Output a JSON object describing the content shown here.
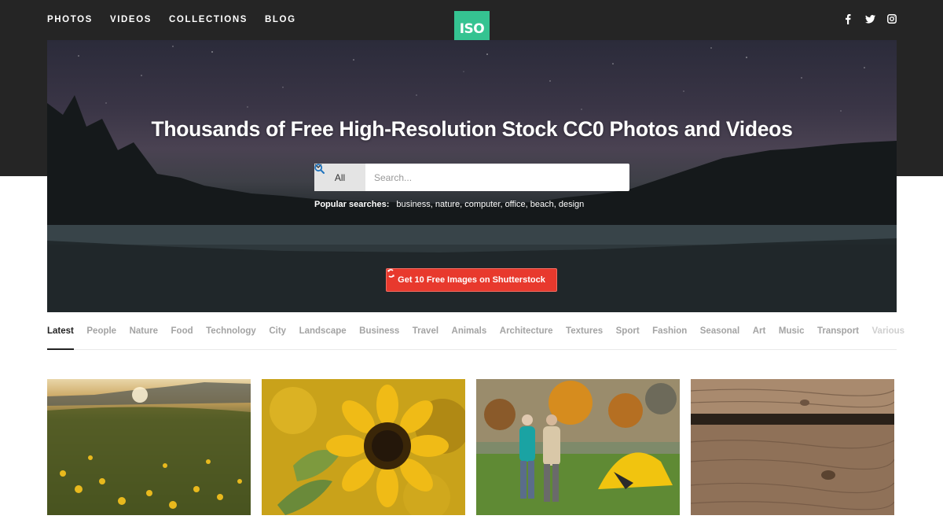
{
  "nav": {
    "items": [
      {
        "label": "PHOTOS"
      },
      {
        "label": "VIDEOS"
      },
      {
        "label": "COLLECTIONS"
      },
      {
        "label": "BLOG"
      }
    ]
  },
  "logo": {
    "text": "ISO",
    "color": "#35c391"
  },
  "social": [
    "facebook-icon",
    "twitter-icon",
    "instagram-icon"
  ],
  "hero": {
    "title": "Thousands of Free High-Resolution Stock CC0 Photos and Videos",
    "search": {
      "category": "All",
      "placeholder": "Search..."
    },
    "popular": {
      "label": "Popular searches:",
      "terms": "business, nature, computer, office, beach, design"
    },
    "cta": {
      "label": "Get 10 Free Images on Shutterstock",
      "color": "#e8392d"
    }
  },
  "tabs": [
    {
      "label": "Latest"
    },
    {
      "label": "People"
    },
    {
      "label": "Nature"
    },
    {
      "label": "Food"
    },
    {
      "label": "Technology"
    },
    {
      "label": "City"
    },
    {
      "label": "Landscape"
    },
    {
      "label": "Business"
    },
    {
      "label": "Travel"
    },
    {
      "label": "Animals"
    },
    {
      "label": "Architecture"
    },
    {
      "label": "Textures"
    },
    {
      "label": "Sport"
    },
    {
      "label": "Fashion"
    },
    {
      "label": "Seasonal"
    },
    {
      "label": "Art"
    },
    {
      "label": "Music"
    },
    {
      "label": "Transport"
    },
    {
      "label": "Various"
    }
  ]
}
